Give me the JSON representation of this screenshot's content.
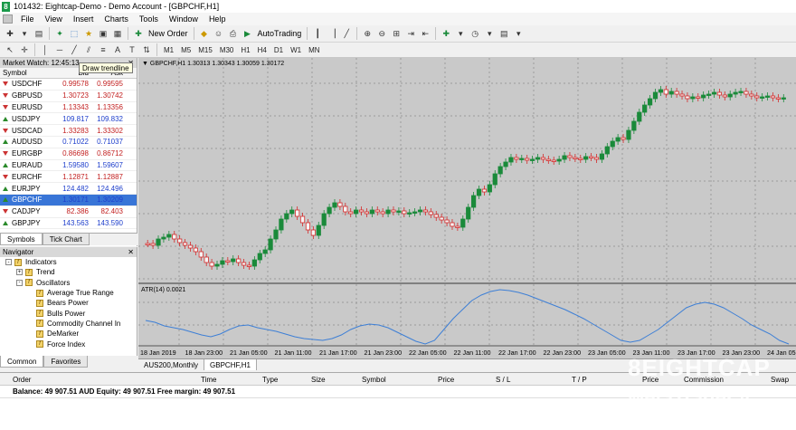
{
  "window": {
    "title": "101432: Eightcap-Demo - Demo Account - [GBPCHF,H1]",
    "logo": "8"
  },
  "menu": [
    "File",
    "View",
    "Insert",
    "Charts",
    "Tools",
    "Window",
    "Help"
  ],
  "toolbar": {
    "new_order": "New Order",
    "autotrading": "AutoTrading"
  },
  "timeframes": [
    "M1",
    "M5",
    "M15",
    "M30",
    "H1",
    "H4",
    "D1",
    "W1",
    "MN"
  ],
  "tooltip": "Draw trendline",
  "market_watch": {
    "title": "Market Watch: 12:45:13",
    "cols": {
      "symbol": "Symbol",
      "bid": "Bid",
      "ask": "Ask"
    },
    "rows": [
      {
        "symbol": "USDCHF",
        "bid": "0.99578",
        "ask": "0.99595",
        "dir": "down"
      },
      {
        "symbol": "GBPUSD",
        "bid": "1.30723",
        "ask": "1.30742",
        "dir": "down"
      },
      {
        "symbol": "EURUSD",
        "bid": "1.13343",
        "ask": "1.13356",
        "dir": "down"
      },
      {
        "symbol": "USDJPY",
        "bid": "109.817",
        "ask": "109.832",
        "dir": "up"
      },
      {
        "symbol": "USDCAD",
        "bid": "1.33283",
        "ask": "1.33302",
        "dir": "down"
      },
      {
        "symbol": "AUDUSD",
        "bid": "0.71022",
        "ask": "0.71037",
        "dir": "up"
      },
      {
        "symbol": "EURGBP",
        "bid": "0.86698",
        "ask": "0.86712",
        "dir": "down"
      },
      {
        "symbol": "EURAUD",
        "bid": "1.59580",
        "ask": "1.59607",
        "dir": "up"
      },
      {
        "symbol": "EURCHF",
        "bid": "1.12871",
        "ask": "1.12887",
        "dir": "down"
      },
      {
        "symbol": "EURJPY",
        "bid": "124.482",
        "ask": "124.496",
        "dir": "up"
      },
      {
        "symbol": "GBPCHF",
        "bid": "1.30171",
        "ask": "1.30209",
        "dir": "up",
        "selected": true
      },
      {
        "symbol": "CADJPY",
        "bid": "82.386",
        "ask": "82.403",
        "dir": "down"
      },
      {
        "symbol": "GBPJPY",
        "bid": "143.563",
        "ask": "143.590",
        "dir": "up"
      }
    ],
    "tabs": [
      "Symbols",
      "Tick Chart"
    ]
  },
  "navigator": {
    "title": "Navigator",
    "items": [
      {
        "label": "Indicators",
        "level": 0,
        "pm": "-"
      },
      {
        "label": "Trend",
        "level": 1,
        "pm": "+"
      },
      {
        "label": "Oscillators",
        "level": 1,
        "pm": "-"
      },
      {
        "label": "Average True Range",
        "level": 2
      },
      {
        "label": "Bears Power",
        "level": 2
      },
      {
        "label": "Bulls Power",
        "level": 2
      },
      {
        "label": "Commodity Channel In",
        "level": 2
      },
      {
        "label": "DeMarker",
        "level": 2
      },
      {
        "label": "Force Index",
        "level": 2
      }
    ],
    "tabs": [
      "Common",
      "Favorites"
    ]
  },
  "chart": {
    "header": "GBPCHF,H1  1.30313 1.30343 1.30059 1.30172",
    "indicator_label": "ATR(14) 0.0021",
    "xlabels": [
      "18 Jan 2019",
      "18 Jan 23:00",
      "21 Jan 05:00",
      "21 Jan 11:00",
      "21 Jan 17:00",
      "21 Jan 23:00",
      "22 Jan 05:00",
      "22 Jan 11:00",
      "22 Jan 17:00",
      "22 Jan 23:00",
      "23 Jan 05:00",
      "23 Jan 11:00",
      "23 Jan 17:00",
      "23 Jan 23:00",
      "24 Jan 05"
    ],
    "tabs": [
      "AUS200,Monthly",
      "GBPCHF,H1"
    ]
  },
  "terminal": {
    "cols": [
      "Order",
      "Time",
      "Type",
      "Size",
      "Symbol",
      "Price",
      "S / L",
      "T / P",
      "Price",
      "Commission",
      "Swap"
    ],
    "balance_line": "Balance: 49 907.51 AUD  Equity: 49 907.51  Free margin: 49 907.51"
  },
  "brand": {
    "line1": "8EIGHTCAP",
    "line2": "MetaTrader 4"
  },
  "colors": {
    "bull": "#1a8a3a",
    "bear": "#d42a2a",
    "atr": "#3d7fd6",
    "selected": "#3875d7"
  }
}
